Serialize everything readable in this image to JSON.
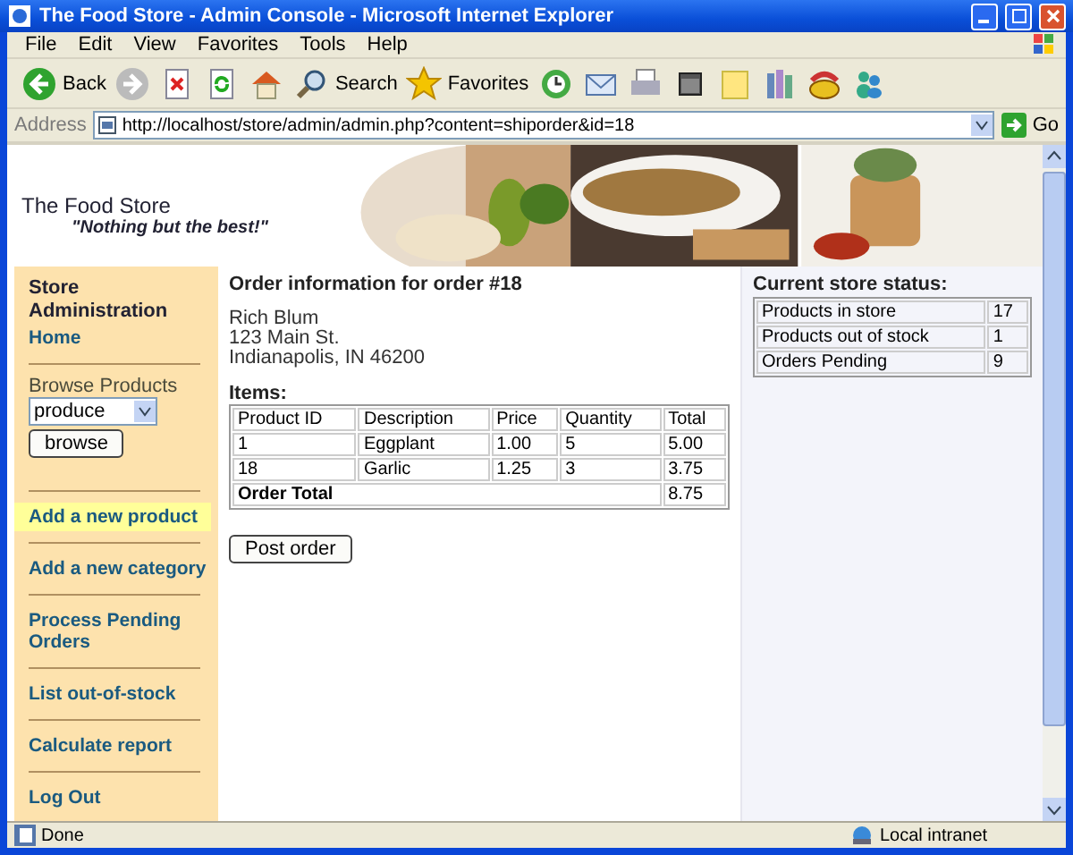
{
  "window": {
    "title": "The Food Store - Admin Console - Microsoft Internet Explorer"
  },
  "menu": [
    "File",
    "Edit",
    "View",
    "Favorites",
    "Tools",
    "Help"
  ],
  "toolbar": [
    {
      "kind": "back",
      "label": "Back"
    },
    {
      "kind": "forward"
    },
    {
      "kind": "stop"
    },
    {
      "kind": "refresh"
    },
    {
      "kind": "home"
    },
    {
      "kind": "search",
      "label": "Search"
    },
    {
      "kind": "favorites",
      "label": "Favorites"
    },
    {
      "kind": "history"
    },
    {
      "kind": "mail"
    },
    {
      "kind": "print"
    },
    {
      "kind": "edit"
    },
    {
      "kind": "note"
    },
    {
      "kind": "research"
    },
    {
      "kind": "phone"
    },
    {
      "kind": "messenger"
    }
  ],
  "address": {
    "label": "Address",
    "url": "http://localhost/store/admin/admin.php?content=shiporder&id=18",
    "go": "Go"
  },
  "header": {
    "title": "The Food Store",
    "slogan": "\"Nothing but the best!\""
  },
  "sidebar": {
    "heading": "Store Administration",
    "home": "Home",
    "browse_label": "Browse Products",
    "category": "produce",
    "browse_button": "browse",
    "links": [
      {
        "label": "Add a new product",
        "selected": true
      },
      {
        "label": "Add a new category",
        "selected": false
      },
      {
        "label": "Process Pending Orders",
        "selected": false
      },
      {
        "label": "List out-of-stock",
        "selected": false
      },
      {
        "label": "Calculate report",
        "selected": false
      },
      {
        "label": "Log Out",
        "selected": false
      }
    ]
  },
  "order": {
    "title": "Order information for order #18",
    "address": [
      "Rich Blum",
      "123 Main St.",
      "Indianapolis, IN 46200"
    ],
    "items_label": "Items:",
    "columns": [
      "Product ID",
      "Description",
      "Price",
      "Quantity",
      "Total"
    ],
    "rows": [
      [
        "1",
        "Eggplant",
        "1.00",
        "5",
        "5.00"
      ],
      [
        "18",
        "Garlic",
        "1.25",
        "3",
        "3.75"
      ]
    ],
    "total_label": "Order Total",
    "total": "8.75",
    "button": "Post order"
  },
  "store_status": {
    "title": "Current store status:",
    "rows": [
      [
        "Products in store",
        "17"
      ],
      [
        "Products out of stock",
        "1"
      ],
      [
        "Orders Pending",
        "9"
      ]
    ]
  },
  "status_bar": {
    "text": "Done",
    "zone": "Local intranet"
  }
}
